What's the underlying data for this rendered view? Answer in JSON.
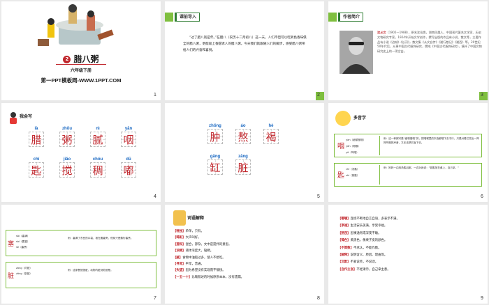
{
  "slides": [
    {
      "num": "1",
      "lesson_no": "2",
      "title": "腊八粥",
      "grade": "六年级下册",
      "site": "第一PPT模板网-WWW.1PPT.COM"
    },
    {
      "num": "2",
      "header": "课前导入",
      "text": "“过了腊八就是年。”在腊八（农历十二月初八）这一天，人们不但可以吃到色香味俱全的腊八粥，更能吸上香甜诱人的腊八粥。今天我们就跟随人们的脚步，感受腊八粥带给人们的兴奋和喜悦。"
    },
    {
      "num": "3",
      "header": "作者简介",
      "author_name": "沈从文",
      "bio": "（1902—1988），原名沈岳焕，湖南凤凰人，中国现代著名文学家、历史文物研究专家。1924年开始文学创作，撰写出版的作品有小说、散文等，主要作品有小说《边城》《长河》，散文集《从文自传》《湘行散记》《湘西》等。20世纪50年代后，从事中国古代服饰研究，撰成《中国古代服饰研究》，填补了中国文物研究史上的一项空白。"
    },
    {
      "num": "4",
      "header": "我会写",
      "chars": [
        {
          "py": "là",
          "ch": "腊"
        },
        {
          "py": "zhōu",
          "ch": "粥"
        },
        {
          "py": "nì",
          "ch": "腻"
        },
        {
          "py": "yān",
          "ch": "咽"
        },
        {
          "py": "chí",
          "ch": "匙"
        },
        {
          "py": "jiǎo",
          "ch": "搅"
        },
        {
          "py": "chóu",
          "ch": "稠"
        },
        {
          "py": "dū",
          "ch": "嘟"
        }
      ]
    },
    {
      "num": "5",
      "chars": [
        {
          "py": "zhǒng",
          "ch": "肿"
        },
        {
          "py": "áo",
          "ch": "熬"
        },
        {
          "py": "hè",
          "ch": "褐"
        },
        {
          "py": "gāng",
          "ch": "缸"
        },
        {
          "py": "zāng",
          "ch": "脏"
        }
      ]
    },
    {
      "num": "6",
      "header": "多音字",
      "items": [
        {
          "char": "咽",
          "readings": "yàn（细嚼慢咽）\nyān（咽喉）\nyè（呜咽）",
          "example": "例：这一种粥可是“细嚼慢咽”的，把咽喉里的东西都咽下去才行，只是对着它发出一阵阵呜咽的声音，又无法把它吞下去。"
        },
        {
          "char": "匙",
          "readings": "chí（汤匙）\nshi（钥匙）",
          "example": "例：妈妈一边用汤匙舀粥，一边对我说：“钥匙放在桌上，自己拿。”"
        }
      ]
    },
    {
      "num": "7",
      "items": [
        {
          "char": "塞",
          "readings": "sāi（塞满）\nsài（要塞）\nsè（塞责）",
          "example": "例：塞满了东西的口袋，堆在要塞旁，他却只是敷衍塞责。"
        },
        {
          "char": "脏",
          "readings": "zàng（内脏）\nzāng（肮脏）",
          "example": "例：这家餐馆很脏，动物内脏到处都是。"
        }
      ]
    },
    {
      "num": "8",
      "header": "词语解释",
      "entries": [
        {
          "term": "【唯独】",
          "def": "单单，只有。"
        },
        {
          "term": "【喝彩】",
          "def": "大声叫好。"
        },
        {
          "term": "【搅和】",
          "def": "混合，掺杂。文中是搅拌的意思。"
        },
        {
          "term": "【浓稠】",
          "def": "液体浓度大，黏稠。"
        },
        {
          "term": "【腻】",
          "def": "食物中油脂过多，使人不想吃。"
        },
        {
          "term": "【寻常】",
          "def": "平常，普通。"
        },
        {
          "term": "【失望】",
          "def": "因为希望没有实现而不愉快。"
        },
        {
          "term": "【一五一十】",
          "def": "比喻叙述的时候原原本本，没有遗漏。"
        }
      ]
    },
    {
      "num": "9",
      "entries": [
        {
          "term": "【嘟囔】",
          "def": "连续不断地自言自语，多表示不满。"
        },
        {
          "term": "【享福】",
          "def": "生活安乐美满，享受幸福。"
        },
        {
          "term": "【熬夜】",
          "def": "因事通宵或深夜不睡。"
        },
        {
          "term": "【褐色】",
          "def": "黄黑色，像栗子皮的颜色。"
        },
        {
          "term": "【不算数】",
          "def": "不承认，不能作数。"
        },
        {
          "term": "【解释】",
          "def": "说明含义、原因、理由等。"
        },
        {
          "term": "【沉默】",
          "def": "不爱说笑，不说话。"
        },
        {
          "term": "【自作主张】",
          "def": "不经请示，自己拿主意。"
        }
      ]
    }
  ]
}
